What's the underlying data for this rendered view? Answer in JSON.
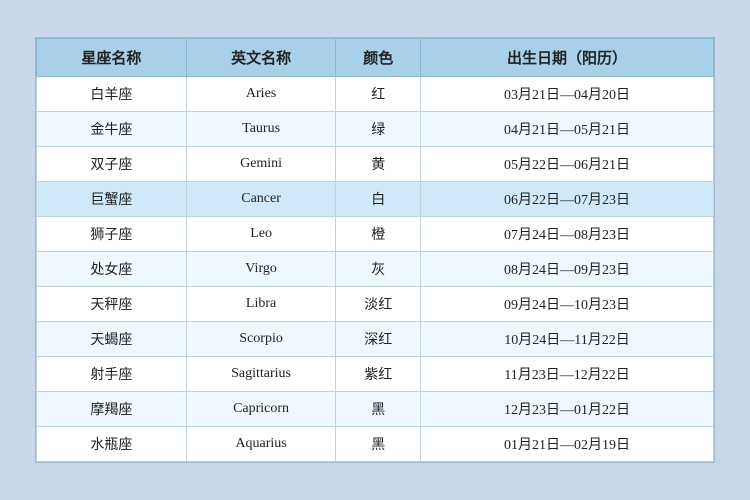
{
  "table": {
    "headers": [
      "星座名称",
      "英文名称",
      "颜色",
      "出生日期（阳历）"
    ],
    "rows": [
      {
        "chinese": "白羊座",
        "english": "Aries",
        "color": "红",
        "dates": "03月21日—04月20日",
        "highlight": false
      },
      {
        "chinese": "金牛座",
        "english": "Taurus",
        "color": "绿",
        "dates": "04月21日—05月21日",
        "highlight": false
      },
      {
        "chinese": "双子座",
        "english": "Gemini",
        "color": "黄",
        "dates": "05月22日—06月21日",
        "highlight": false
      },
      {
        "chinese": "巨蟹座",
        "english": "Cancer",
        "color": "白",
        "dates": "06月22日—07月23日",
        "highlight": true
      },
      {
        "chinese": "狮子座",
        "english": "Leo",
        "color": "橙",
        "dates": "07月24日—08月23日",
        "highlight": false
      },
      {
        "chinese": "处女座",
        "english": "Virgo",
        "color": "灰",
        "dates": "08月24日—09月23日",
        "highlight": false
      },
      {
        "chinese": "天秤座",
        "english": "Libra",
        "color": "淡红",
        "dates": "09月24日—10月23日",
        "highlight": false
      },
      {
        "chinese": "天蝎座",
        "english": "Scorpio",
        "color": "深红",
        "dates": "10月24日—11月22日",
        "highlight": false
      },
      {
        "chinese": "射手座",
        "english": "Sagittarius",
        "color": "紫红",
        "dates": "11月23日—12月22日",
        "highlight": false
      },
      {
        "chinese": "摩羯座",
        "english": "Capricorn",
        "color": "黑",
        "dates": "12月23日—01月22日",
        "highlight": false
      },
      {
        "chinese": "水瓶座",
        "english": "Aquarius",
        "color": "黑",
        "dates": "01月21日—02月19日",
        "highlight": false
      }
    ]
  }
}
